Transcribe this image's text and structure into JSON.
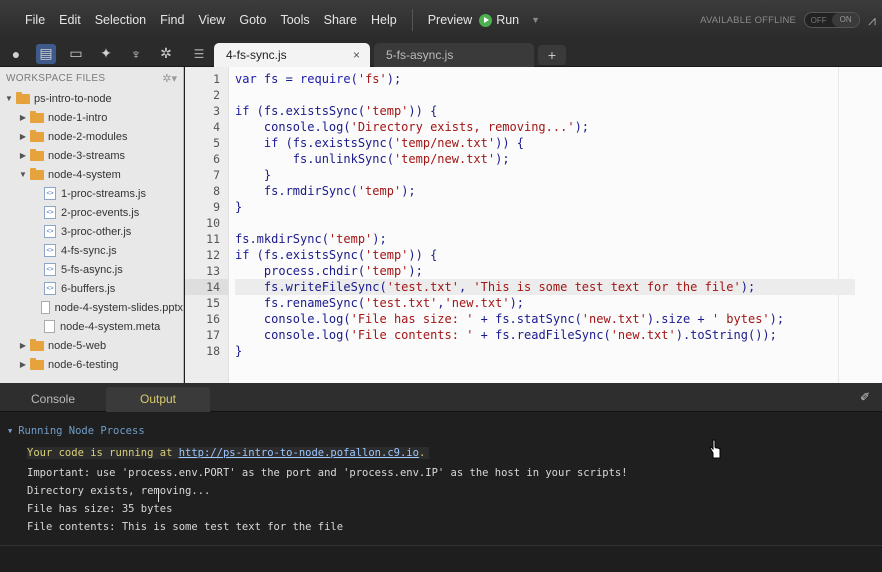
{
  "menubar": {
    "items": [
      "File",
      "Edit",
      "Selection",
      "Find",
      "View",
      "Goto",
      "Tools",
      "Share",
      "Help"
    ],
    "preview_label": "Preview",
    "run_label": "Run",
    "offline_label": "AVAILABLE OFFLINE",
    "toggle_off": "OFF",
    "toggle_on": "ON"
  },
  "toolbar": {
    "icons": [
      "rocket-icon",
      "files-icon",
      "monitor-icon",
      "runner-icon",
      "trophy-icon",
      "gear-icon"
    ]
  },
  "tabs": [
    {
      "label": "4-fs-sync.js",
      "active": true
    },
    {
      "label": "5-fs-async.js",
      "active": false
    }
  ],
  "sidebar": {
    "title": "WORKSPACE FILES",
    "tree": [
      {
        "label": "ps-intro-to-node",
        "type": "folder",
        "depth": 0,
        "expanded": true
      },
      {
        "label": "node-1-intro",
        "type": "folder",
        "depth": 1,
        "expanded": false
      },
      {
        "label": "node-2-modules",
        "type": "folder",
        "depth": 1,
        "expanded": false
      },
      {
        "label": "node-3-streams",
        "type": "folder",
        "depth": 1,
        "expanded": false
      },
      {
        "label": "node-4-system",
        "type": "folder",
        "depth": 1,
        "expanded": true
      },
      {
        "label": "1-proc-streams.js",
        "type": "js",
        "depth": 2
      },
      {
        "label": "2-proc-events.js",
        "type": "js",
        "depth": 2
      },
      {
        "label": "3-proc-other.js",
        "type": "js",
        "depth": 2
      },
      {
        "label": "4-fs-sync.js",
        "type": "js",
        "depth": 2
      },
      {
        "label": "5-fs-async.js",
        "type": "js",
        "depth": 2
      },
      {
        "label": "6-buffers.js",
        "type": "js",
        "depth": 2
      },
      {
        "label": "node-4-system-slides.pptx",
        "type": "file",
        "depth": 2
      },
      {
        "label": "node-4-system.meta",
        "type": "file",
        "depth": 2
      },
      {
        "label": "node-5-web",
        "type": "folder",
        "depth": 1,
        "expanded": false
      },
      {
        "label": "node-6-testing",
        "type": "folder",
        "depth": 1,
        "expanded": false
      }
    ]
  },
  "editor": {
    "current_line": 14,
    "lines": [
      "var fs = require('fs');",
      "",
      "if (fs.existsSync('temp')) {",
      "    console.log('Directory exists, removing...');",
      "    if (fs.existsSync('temp/new.txt')) {",
      "        fs.unlinkSync('temp/new.txt');",
      "    }",
      "    fs.rmdirSync('temp');",
      "}",
      "",
      "fs.mkdirSync('temp');",
      "if (fs.existsSync('temp')) {",
      "    process.chdir('temp');",
      "    fs.writeFileSync('test.txt', 'This is some test text for the file');",
      "    fs.renameSync('test.txt','new.txt');",
      "    console.log('File has size: ' + fs.statSync('new.txt').size + ' bytes');",
      "    console.log('File contents: ' + fs.readFileSync('new.txt').toString());",
      "}"
    ]
  },
  "panel": {
    "tabs": [
      "Console",
      "Output"
    ],
    "active_tab": "Output",
    "process_title": "Running Node Process",
    "running_prefix": "Your code is running at ",
    "running_url": "http://ps-intro-to-node.pofallon.c9.io",
    "running_suffix": ".",
    "output_lines": [
      "Important: use 'process.env.PORT' as the port and 'process.env.IP' as the host in your scripts!",
      "Directory exists, removing...",
      "File has size: 35 bytes",
      "File contents: This is some test text for the file"
    ]
  }
}
